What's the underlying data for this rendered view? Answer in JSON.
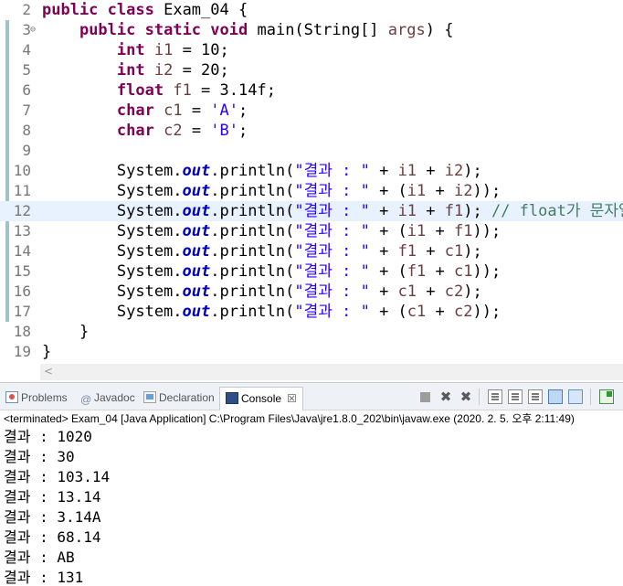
{
  "editor": {
    "current_line": 12,
    "lines": [
      {
        "num": "2",
        "fold": "",
        "tokens": [
          [
            "kw",
            "public"
          ],
          [
            "",
            " "
          ],
          [
            "kw",
            "class"
          ],
          [
            "",
            " Exam_04 {"
          ]
        ]
      },
      {
        "num": "3",
        "fold": "⊖",
        "tokens": [
          [
            "",
            "    "
          ],
          [
            "kw",
            "public"
          ],
          [
            "",
            " "
          ],
          [
            "kw",
            "static"
          ],
          [
            "",
            " "
          ],
          [
            "kw",
            "void"
          ],
          [
            "",
            " main(String[] "
          ],
          [
            "var",
            "args"
          ],
          [
            "",
            ") {"
          ]
        ]
      },
      {
        "num": "4",
        "fold": "",
        "tokens": [
          [
            "",
            "        "
          ],
          [
            "kw",
            "int"
          ],
          [
            "",
            " "
          ],
          [
            "var",
            "i1"
          ],
          [
            "",
            " = 10;"
          ]
        ]
      },
      {
        "num": "5",
        "fold": "",
        "tokens": [
          [
            "",
            "        "
          ],
          [
            "kw",
            "int"
          ],
          [
            "",
            " "
          ],
          [
            "var",
            "i2"
          ],
          [
            "",
            " = 20;"
          ]
        ]
      },
      {
        "num": "6",
        "fold": "",
        "tokens": [
          [
            "",
            "        "
          ],
          [
            "kw",
            "float"
          ],
          [
            "",
            " "
          ],
          [
            "var",
            "f1"
          ],
          [
            "",
            " = 3.14f;"
          ]
        ]
      },
      {
        "num": "7",
        "fold": "",
        "tokens": [
          [
            "",
            "        "
          ],
          [
            "kw",
            "char"
          ],
          [
            "",
            " "
          ],
          [
            "var",
            "c1"
          ],
          [
            "",
            " = "
          ],
          [
            "str",
            "'A'"
          ],
          [
            "",
            ";"
          ]
        ]
      },
      {
        "num": "8",
        "fold": "",
        "tokens": [
          [
            "",
            "        "
          ],
          [
            "kw",
            "char"
          ],
          [
            "",
            " "
          ],
          [
            "var",
            "c2"
          ],
          [
            "",
            " = "
          ],
          [
            "str",
            "'B'"
          ],
          [
            "",
            ";"
          ]
        ]
      },
      {
        "num": "9",
        "fold": "",
        "tokens": []
      },
      {
        "num": "10",
        "fold": "",
        "tokens": [
          [
            "",
            "        System."
          ],
          [
            "fld",
            "out"
          ],
          [
            "",
            ".println("
          ],
          [
            "str",
            "\"결과 : \""
          ],
          [
            "",
            " + "
          ],
          [
            "var",
            "i1"
          ],
          [
            "",
            " + "
          ],
          [
            "var",
            "i2"
          ],
          [
            "",
            ");"
          ]
        ]
      },
      {
        "num": "11",
        "fold": "",
        "tokens": [
          [
            "",
            "        System."
          ],
          [
            "fld",
            "out"
          ],
          [
            "",
            ".println("
          ],
          [
            "str",
            "\"결과 : \""
          ],
          [
            "",
            " + ("
          ],
          [
            "var",
            "i1"
          ],
          [
            "",
            " + "
          ],
          [
            "var",
            "i2"
          ],
          [
            "",
            "));"
          ]
        ]
      },
      {
        "num": "12",
        "fold": "",
        "tokens": [
          [
            "",
            "        System."
          ],
          [
            "fld",
            "out"
          ],
          [
            "",
            ".println("
          ],
          [
            "str",
            "\"결과 : \""
          ],
          [
            "",
            " + "
          ],
          [
            "var",
            "i1"
          ],
          [
            "",
            " + "
          ],
          [
            "var",
            "f1"
          ],
          [
            "",
            "); "
          ],
          [
            "cmt",
            "// float가 문자열로"
          ]
        ]
      },
      {
        "num": "13",
        "fold": "",
        "tokens": [
          [
            "",
            "        System."
          ],
          [
            "fld",
            "out"
          ],
          [
            "",
            ".println("
          ],
          [
            "str",
            "\"결과 : \""
          ],
          [
            "",
            " + ("
          ],
          [
            "var",
            "i1"
          ],
          [
            "",
            " + "
          ],
          [
            "var",
            "f1"
          ],
          [
            "",
            "));"
          ]
        ]
      },
      {
        "num": "14",
        "fold": "",
        "tokens": [
          [
            "",
            "        System."
          ],
          [
            "fld",
            "out"
          ],
          [
            "",
            ".println("
          ],
          [
            "str",
            "\"결과 : \""
          ],
          [
            "",
            " + "
          ],
          [
            "var",
            "f1"
          ],
          [
            "",
            " + "
          ],
          [
            "var",
            "c1"
          ],
          [
            "",
            ");"
          ]
        ]
      },
      {
        "num": "15",
        "fold": "",
        "tokens": [
          [
            "",
            "        System."
          ],
          [
            "fld",
            "out"
          ],
          [
            "",
            ".println("
          ],
          [
            "str",
            "\"결과 : \""
          ],
          [
            "",
            " + ("
          ],
          [
            "var",
            "f1"
          ],
          [
            "",
            " + "
          ],
          [
            "var",
            "c1"
          ],
          [
            "",
            "));"
          ]
        ]
      },
      {
        "num": "16",
        "fold": "",
        "tokens": [
          [
            "",
            "        System."
          ],
          [
            "fld",
            "out"
          ],
          [
            "",
            ".println("
          ],
          [
            "str",
            "\"결과 : \""
          ],
          [
            "",
            " + "
          ],
          [
            "var",
            "c1"
          ],
          [
            "",
            " + "
          ],
          [
            "var",
            "c2"
          ],
          [
            "",
            ");"
          ]
        ]
      },
      {
        "num": "17",
        "fold": "",
        "tokens": [
          [
            "",
            "        System."
          ],
          [
            "fld",
            "out"
          ],
          [
            "",
            ".println("
          ],
          [
            "str",
            "\"결과 : \""
          ],
          [
            "",
            " + ("
          ],
          [
            "var",
            "c1"
          ],
          [
            "",
            " + "
          ],
          [
            "var",
            "c2"
          ],
          [
            "",
            "));"
          ]
        ]
      },
      {
        "num": "18",
        "fold": "",
        "tokens": [
          [
            "",
            "    }"
          ]
        ]
      },
      {
        "num": "19",
        "fold": "",
        "tokens": [
          [
            "",
            "}"
          ]
        ]
      }
    ],
    "scroll_left_arrow": "<"
  },
  "console_view": {
    "tabs": [
      {
        "label": "Problems",
        "icon": "problems-icon"
      },
      {
        "label": "Javadoc",
        "icon": "javadoc-icon"
      },
      {
        "label": "Declaration",
        "icon": "declaration-icon"
      },
      {
        "label": "Console",
        "icon": "console-icon",
        "active": true,
        "close": "☒"
      }
    ],
    "javadoc_glyph": "@",
    "terminate_x": "✖",
    "remove_all_x": "✖",
    "status": "<terminated> Exam_04 [Java Application] C:\\Program Files\\Java\\jre1.8.0_202\\bin\\javaw.exe (2020. 2. 5. 오후 2:11:49)",
    "output": [
      "결과 : 1020",
      "결과 : 30",
      "결과 : 103.14",
      "결과 : 13.14",
      "결과 : 3.14A",
      "결과 : 68.14",
      "결과 : AB",
      "결과 : 131"
    ]
  }
}
